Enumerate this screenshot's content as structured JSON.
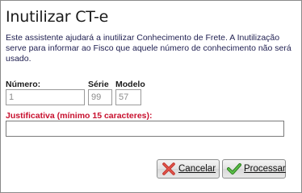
{
  "dialog": {
    "title": "Inutilizar CT-e",
    "description": "Este assistente ajudará a inutilizar Conhecimento de Frete. A Inutilização serve para informar ao Fisco que aquele número de conhecimento não será usado."
  },
  "form": {
    "numero": {
      "label": "Número:",
      "value": "1"
    },
    "serie": {
      "label": "Série",
      "value": "99"
    },
    "modelo": {
      "label": "Modelo",
      "value": "57"
    },
    "justificativa": {
      "label": "Justificativa (mínimo 15 caracteres):",
      "value": ""
    }
  },
  "buttons": {
    "cancel": {
      "label": "Cancelar",
      "icon": "close-x-icon"
    },
    "process": {
      "label": "Processar",
      "icon": "checkmark-icon"
    }
  },
  "colors": {
    "required_label": "#c8102e",
    "cancel_icon": "#c0302a",
    "process_icon": "#3a9a2a"
  }
}
